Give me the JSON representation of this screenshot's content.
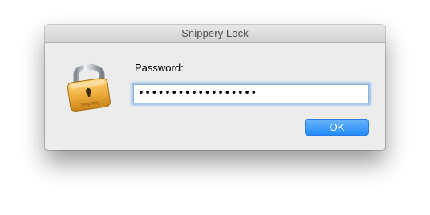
{
  "window": {
    "title": "Snippery Lock"
  },
  "icon": {
    "name": "padlock-icon",
    "engraving": "Snippery"
  },
  "form": {
    "password_label": "Password:",
    "password_value": "••••••••••••••••••"
  },
  "buttons": {
    "ok_label": "OK"
  },
  "colors": {
    "accent": "#2a8bf7",
    "focus_ring": "#a8c9ef",
    "lock_gold": "#e9a93a"
  }
}
